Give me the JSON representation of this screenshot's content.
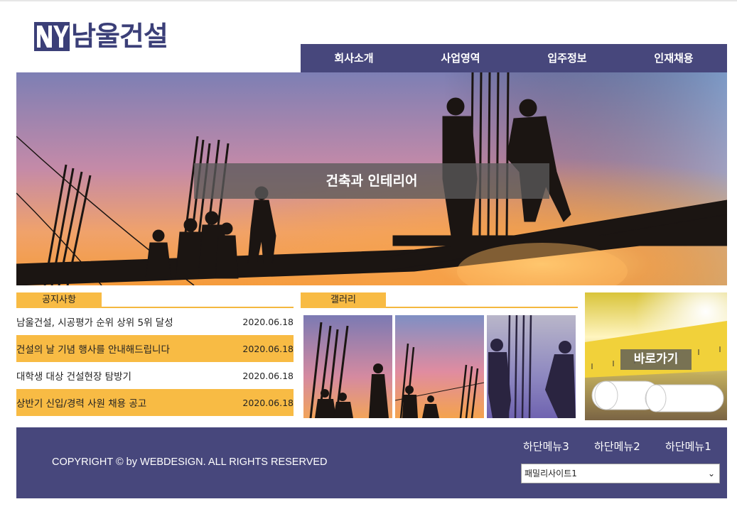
{
  "brand": {
    "logo_text": "남울건설",
    "logo_mark": "NY"
  },
  "nav": {
    "items": [
      "회사소개",
      "사업영역",
      "입주정보",
      "인재채용"
    ]
  },
  "hero": {
    "caption": "건축과 인테리어"
  },
  "notice": {
    "title": "공지사항",
    "rows": [
      {
        "title": "남울건설, 시공평가 순위 상위 5위 달성",
        "date": "2020.06.18"
      },
      {
        "title": "건설의 날 기념 행사를 안내해드립니다",
        "date": "2020.06.18"
      },
      {
        "title": "대학생 대상 건설현장 탐방기",
        "date": "2020.06.18"
      },
      {
        "title": "상반기 신입/경력 사원 채용 공고",
        "date": "2020.06.18"
      }
    ]
  },
  "gallery": {
    "title": "갤러리"
  },
  "shortcut": {
    "label": "바로가기"
  },
  "footer": {
    "copyright": "COPYRIGHT © by WEBDESIGN. ALL RIGHTS RESERVED",
    "menus": [
      "하단메뉴3",
      "하단메뉴2",
      "하단메뉴1"
    ],
    "family_site": {
      "selected": "패밀리사이트1"
    }
  },
  "colors": {
    "brand": "#3b3f78",
    "nav_bg": "#47477c",
    "accent": "#f8bb44"
  }
}
